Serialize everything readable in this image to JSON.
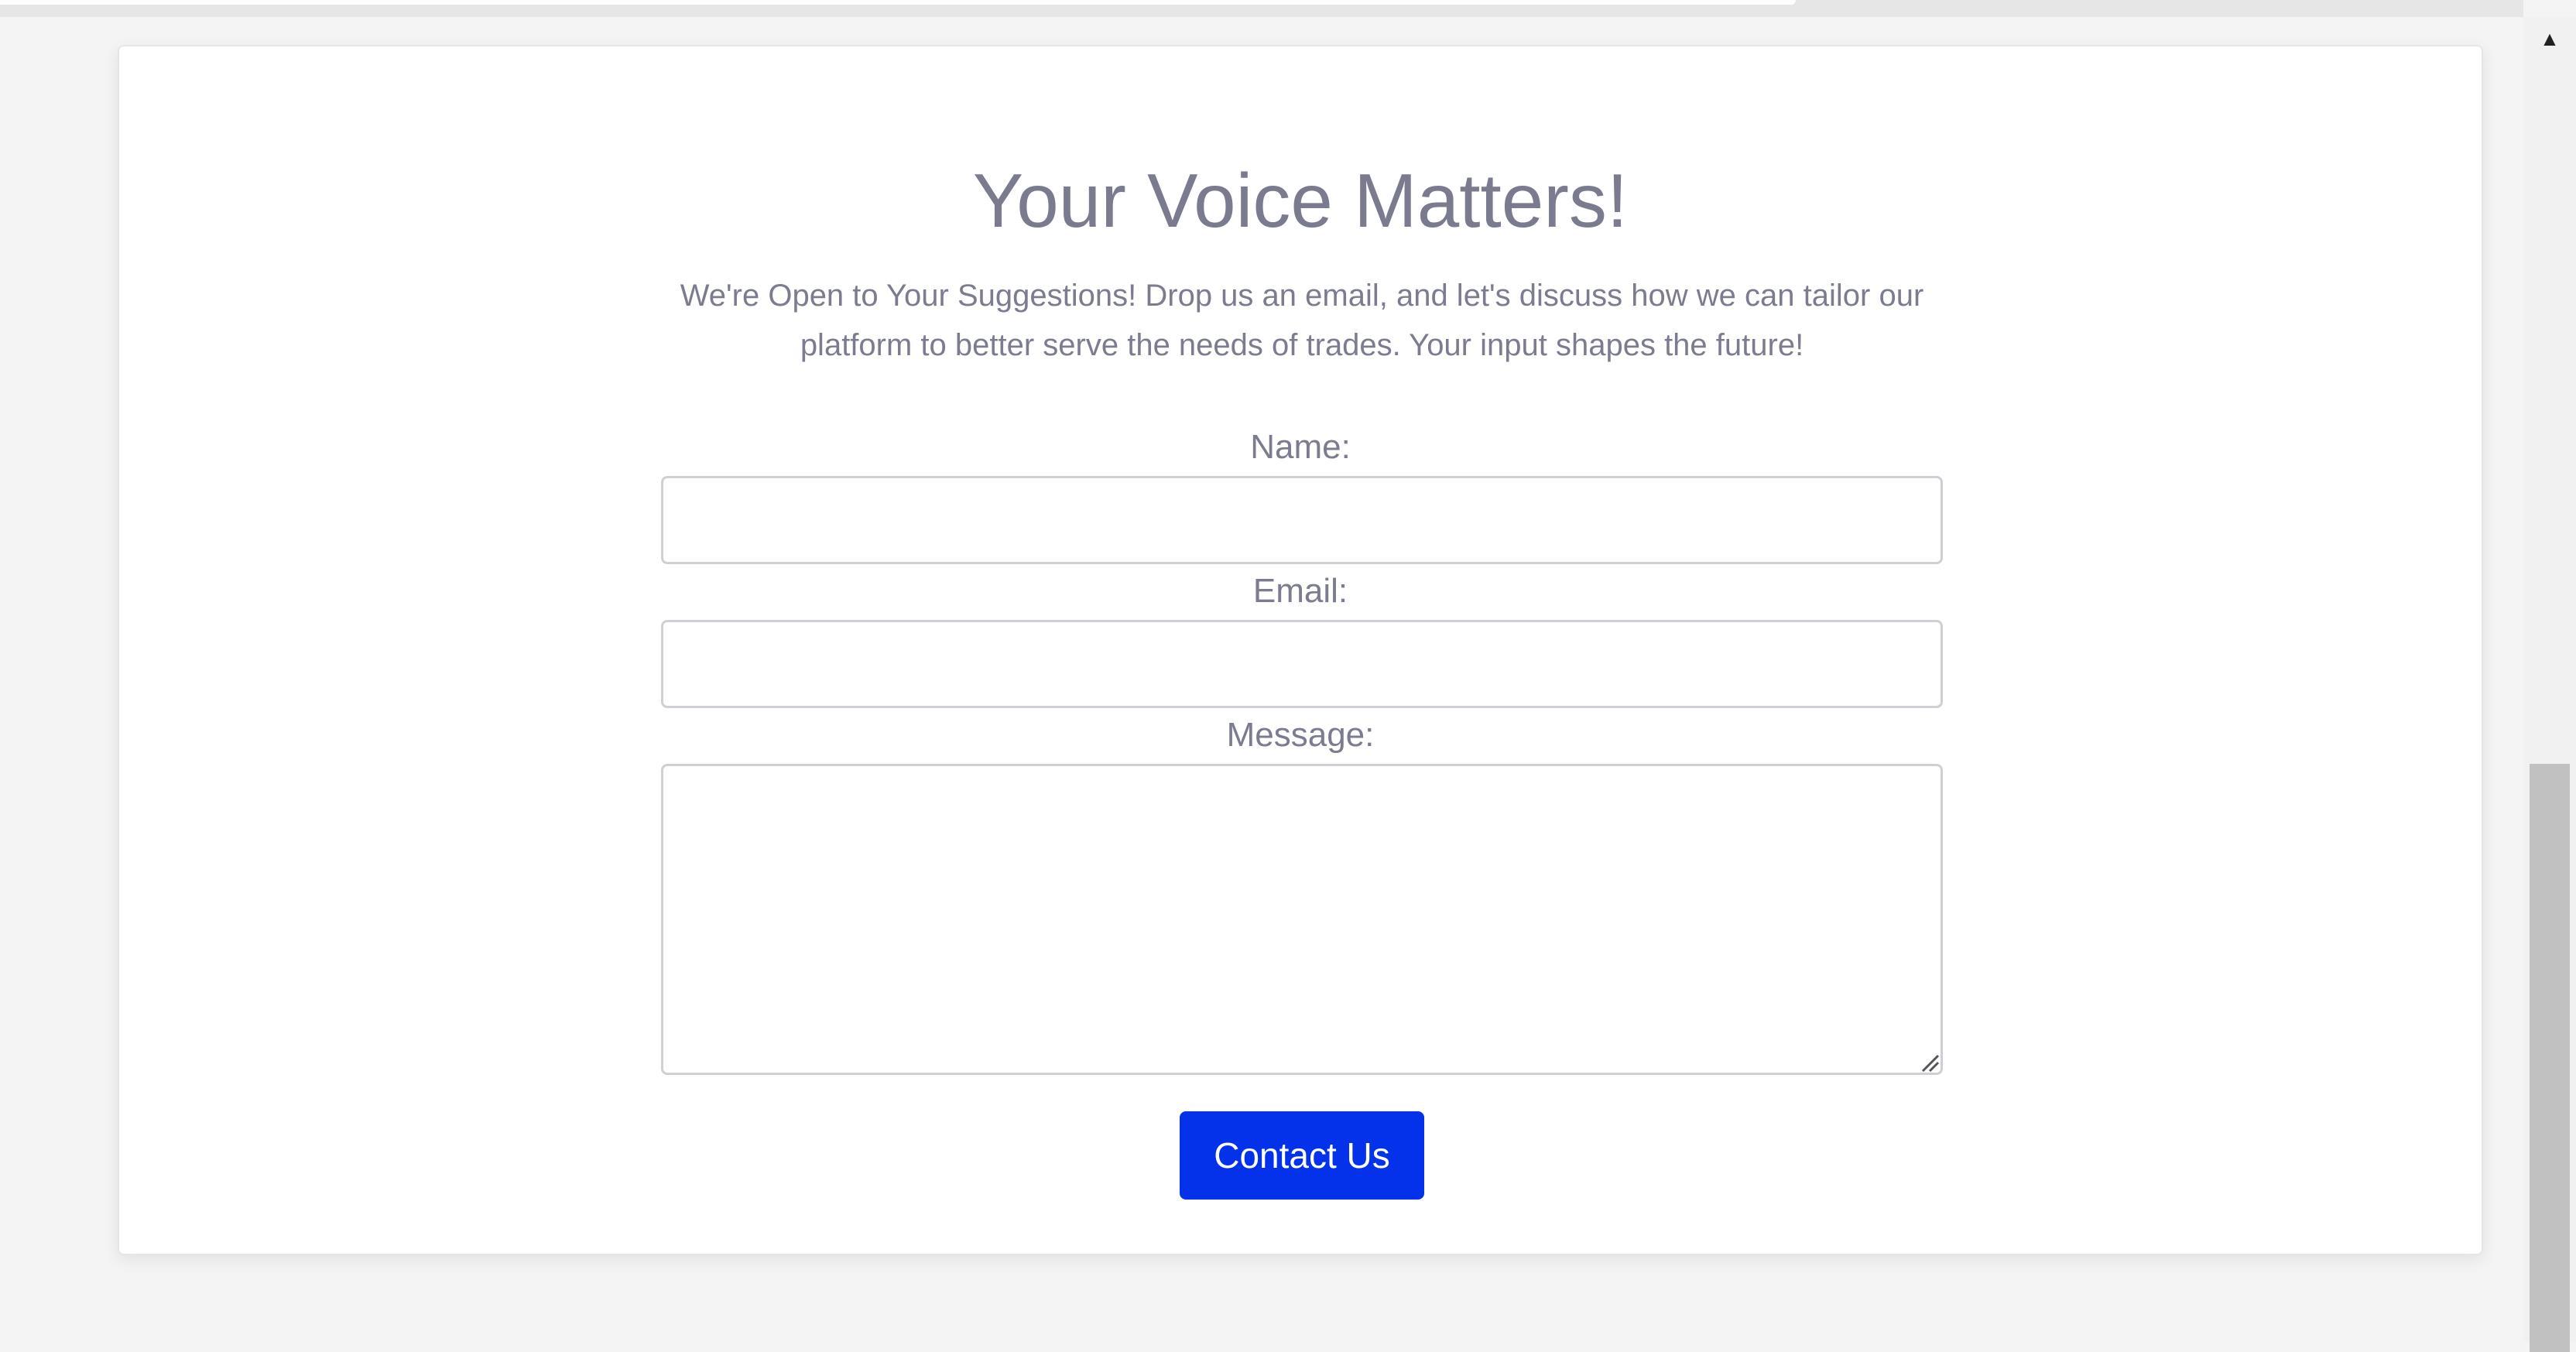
{
  "page": {
    "title": "Your Voice Matters!",
    "intro": "We're Open to Your Suggestions! Drop us an email, and let's discuss how we can tailor our platform to better serve the needs of trades. Your input shapes the future!"
  },
  "form": {
    "name_label": "Name:",
    "name_value": "",
    "email_label": "Email:",
    "email_value": "",
    "message_label": "Message:",
    "message_value": "",
    "submit_label": "Contact Us"
  },
  "colors": {
    "background": "#f4f4f5",
    "card": "#ffffff",
    "text": "#7b7c8f",
    "button": "#0431ea",
    "button_text": "#ffffff",
    "input_border": "#cfd0d6"
  },
  "icons": {
    "scroll_up": "triangle-up-icon",
    "resize": "resize-grip-icon"
  }
}
